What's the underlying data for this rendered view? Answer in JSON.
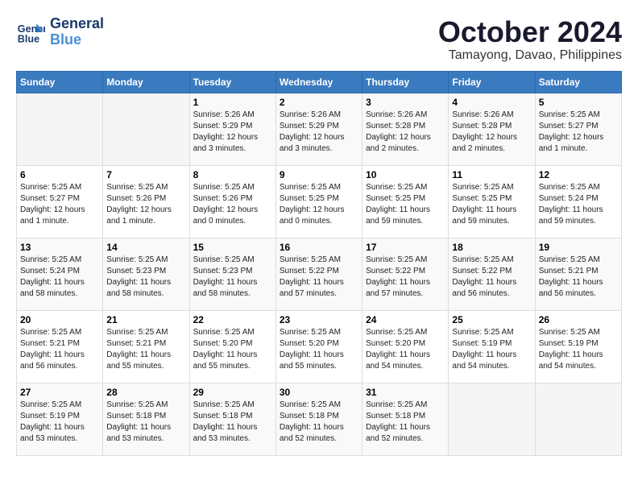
{
  "logo": {
    "line1": "General",
    "line2": "Blue"
  },
  "title": {
    "month": "October 2024",
    "location": "Tamayong, Davao, Philippines"
  },
  "weekdays": [
    "Sunday",
    "Monday",
    "Tuesday",
    "Wednesday",
    "Thursday",
    "Friday",
    "Saturday"
  ],
  "weeks": [
    [
      {
        "day": "",
        "info": ""
      },
      {
        "day": "",
        "info": ""
      },
      {
        "day": "1",
        "info": "Sunrise: 5:26 AM\nSunset: 5:29 PM\nDaylight: 12 hours\nand 3 minutes."
      },
      {
        "day": "2",
        "info": "Sunrise: 5:26 AM\nSunset: 5:29 PM\nDaylight: 12 hours\nand 3 minutes."
      },
      {
        "day": "3",
        "info": "Sunrise: 5:26 AM\nSunset: 5:28 PM\nDaylight: 12 hours\nand 2 minutes."
      },
      {
        "day": "4",
        "info": "Sunrise: 5:26 AM\nSunset: 5:28 PM\nDaylight: 12 hours\nand 2 minutes."
      },
      {
        "day": "5",
        "info": "Sunrise: 5:25 AM\nSunset: 5:27 PM\nDaylight: 12 hours\nand 1 minute."
      }
    ],
    [
      {
        "day": "6",
        "info": "Sunrise: 5:25 AM\nSunset: 5:27 PM\nDaylight: 12 hours\nand 1 minute."
      },
      {
        "day": "7",
        "info": "Sunrise: 5:25 AM\nSunset: 5:26 PM\nDaylight: 12 hours\nand 1 minute."
      },
      {
        "day": "8",
        "info": "Sunrise: 5:25 AM\nSunset: 5:26 PM\nDaylight: 12 hours\nand 0 minutes."
      },
      {
        "day": "9",
        "info": "Sunrise: 5:25 AM\nSunset: 5:25 PM\nDaylight: 12 hours\nand 0 minutes."
      },
      {
        "day": "10",
        "info": "Sunrise: 5:25 AM\nSunset: 5:25 PM\nDaylight: 11 hours\nand 59 minutes."
      },
      {
        "day": "11",
        "info": "Sunrise: 5:25 AM\nSunset: 5:25 PM\nDaylight: 11 hours\nand 59 minutes."
      },
      {
        "day": "12",
        "info": "Sunrise: 5:25 AM\nSunset: 5:24 PM\nDaylight: 11 hours\nand 59 minutes."
      }
    ],
    [
      {
        "day": "13",
        "info": "Sunrise: 5:25 AM\nSunset: 5:24 PM\nDaylight: 11 hours\nand 58 minutes."
      },
      {
        "day": "14",
        "info": "Sunrise: 5:25 AM\nSunset: 5:23 PM\nDaylight: 11 hours\nand 58 minutes."
      },
      {
        "day": "15",
        "info": "Sunrise: 5:25 AM\nSunset: 5:23 PM\nDaylight: 11 hours\nand 58 minutes."
      },
      {
        "day": "16",
        "info": "Sunrise: 5:25 AM\nSunset: 5:22 PM\nDaylight: 11 hours\nand 57 minutes."
      },
      {
        "day": "17",
        "info": "Sunrise: 5:25 AM\nSunset: 5:22 PM\nDaylight: 11 hours\nand 57 minutes."
      },
      {
        "day": "18",
        "info": "Sunrise: 5:25 AM\nSunset: 5:22 PM\nDaylight: 11 hours\nand 56 minutes."
      },
      {
        "day": "19",
        "info": "Sunrise: 5:25 AM\nSunset: 5:21 PM\nDaylight: 11 hours\nand 56 minutes."
      }
    ],
    [
      {
        "day": "20",
        "info": "Sunrise: 5:25 AM\nSunset: 5:21 PM\nDaylight: 11 hours\nand 56 minutes."
      },
      {
        "day": "21",
        "info": "Sunrise: 5:25 AM\nSunset: 5:21 PM\nDaylight: 11 hours\nand 55 minutes."
      },
      {
        "day": "22",
        "info": "Sunrise: 5:25 AM\nSunset: 5:20 PM\nDaylight: 11 hours\nand 55 minutes."
      },
      {
        "day": "23",
        "info": "Sunrise: 5:25 AM\nSunset: 5:20 PM\nDaylight: 11 hours\nand 55 minutes."
      },
      {
        "day": "24",
        "info": "Sunrise: 5:25 AM\nSunset: 5:20 PM\nDaylight: 11 hours\nand 54 minutes."
      },
      {
        "day": "25",
        "info": "Sunrise: 5:25 AM\nSunset: 5:19 PM\nDaylight: 11 hours\nand 54 minutes."
      },
      {
        "day": "26",
        "info": "Sunrise: 5:25 AM\nSunset: 5:19 PM\nDaylight: 11 hours\nand 54 minutes."
      }
    ],
    [
      {
        "day": "27",
        "info": "Sunrise: 5:25 AM\nSunset: 5:19 PM\nDaylight: 11 hours\nand 53 minutes."
      },
      {
        "day": "28",
        "info": "Sunrise: 5:25 AM\nSunset: 5:18 PM\nDaylight: 11 hours\nand 53 minutes."
      },
      {
        "day": "29",
        "info": "Sunrise: 5:25 AM\nSunset: 5:18 PM\nDaylight: 11 hours\nand 53 minutes."
      },
      {
        "day": "30",
        "info": "Sunrise: 5:25 AM\nSunset: 5:18 PM\nDaylight: 11 hours\nand 52 minutes."
      },
      {
        "day": "31",
        "info": "Sunrise: 5:25 AM\nSunset: 5:18 PM\nDaylight: 11 hours\nand 52 minutes."
      },
      {
        "day": "",
        "info": ""
      },
      {
        "day": "",
        "info": ""
      }
    ]
  ]
}
